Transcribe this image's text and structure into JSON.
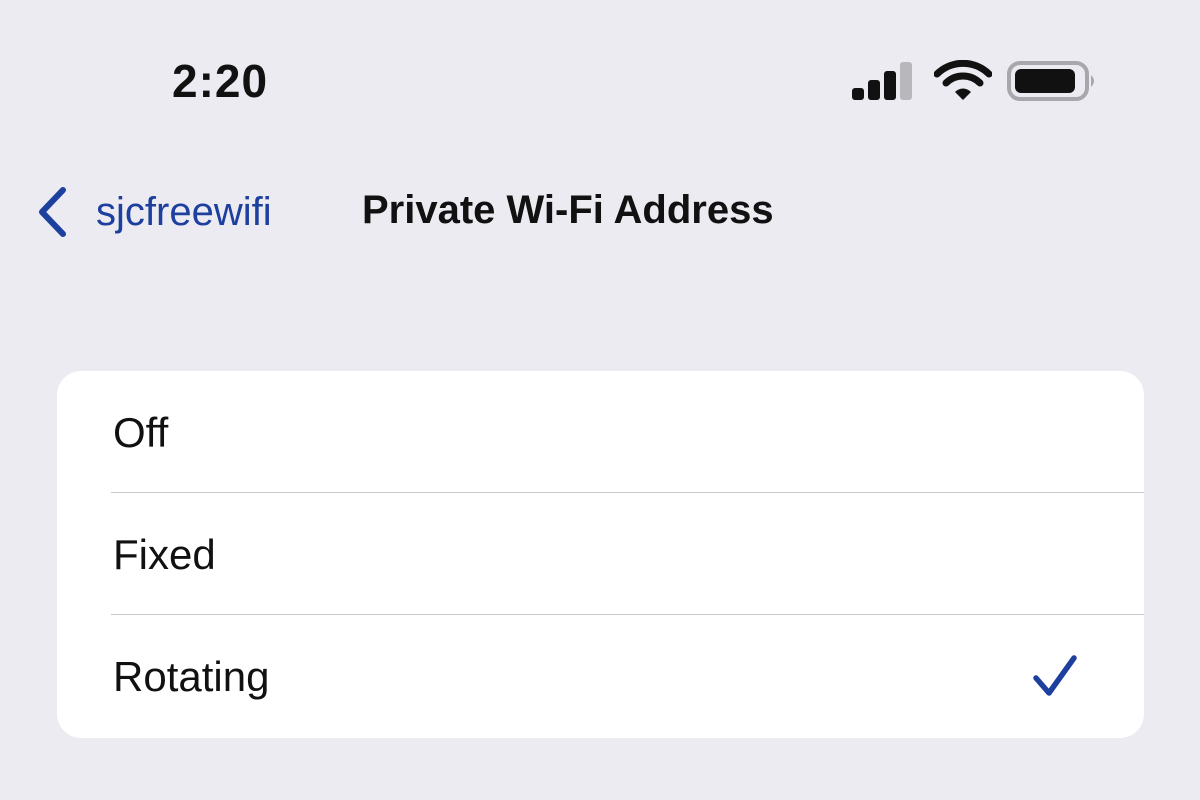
{
  "status_bar": {
    "time": "2:20",
    "icons": [
      "cellular-signal-icon",
      "wifi-icon",
      "battery-icon"
    ]
  },
  "nav": {
    "back_label": "sjcfreewifi",
    "title": "Private Wi-Fi Address",
    "back_icon": "chevron-left-icon"
  },
  "options": [
    {
      "label": "Off",
      "selected": false
    },
    {
      "label": "Fixed",
      "selected": false
    },
    {
      "label": "Rotating",
      "selected": true
    }
  ],
  "colors": {
    "background": "#ebebf1",
    "accent": "#1d3f9e",
    "card": "#ffffff",
    "separator": "#c8c8cc"
  }
}
